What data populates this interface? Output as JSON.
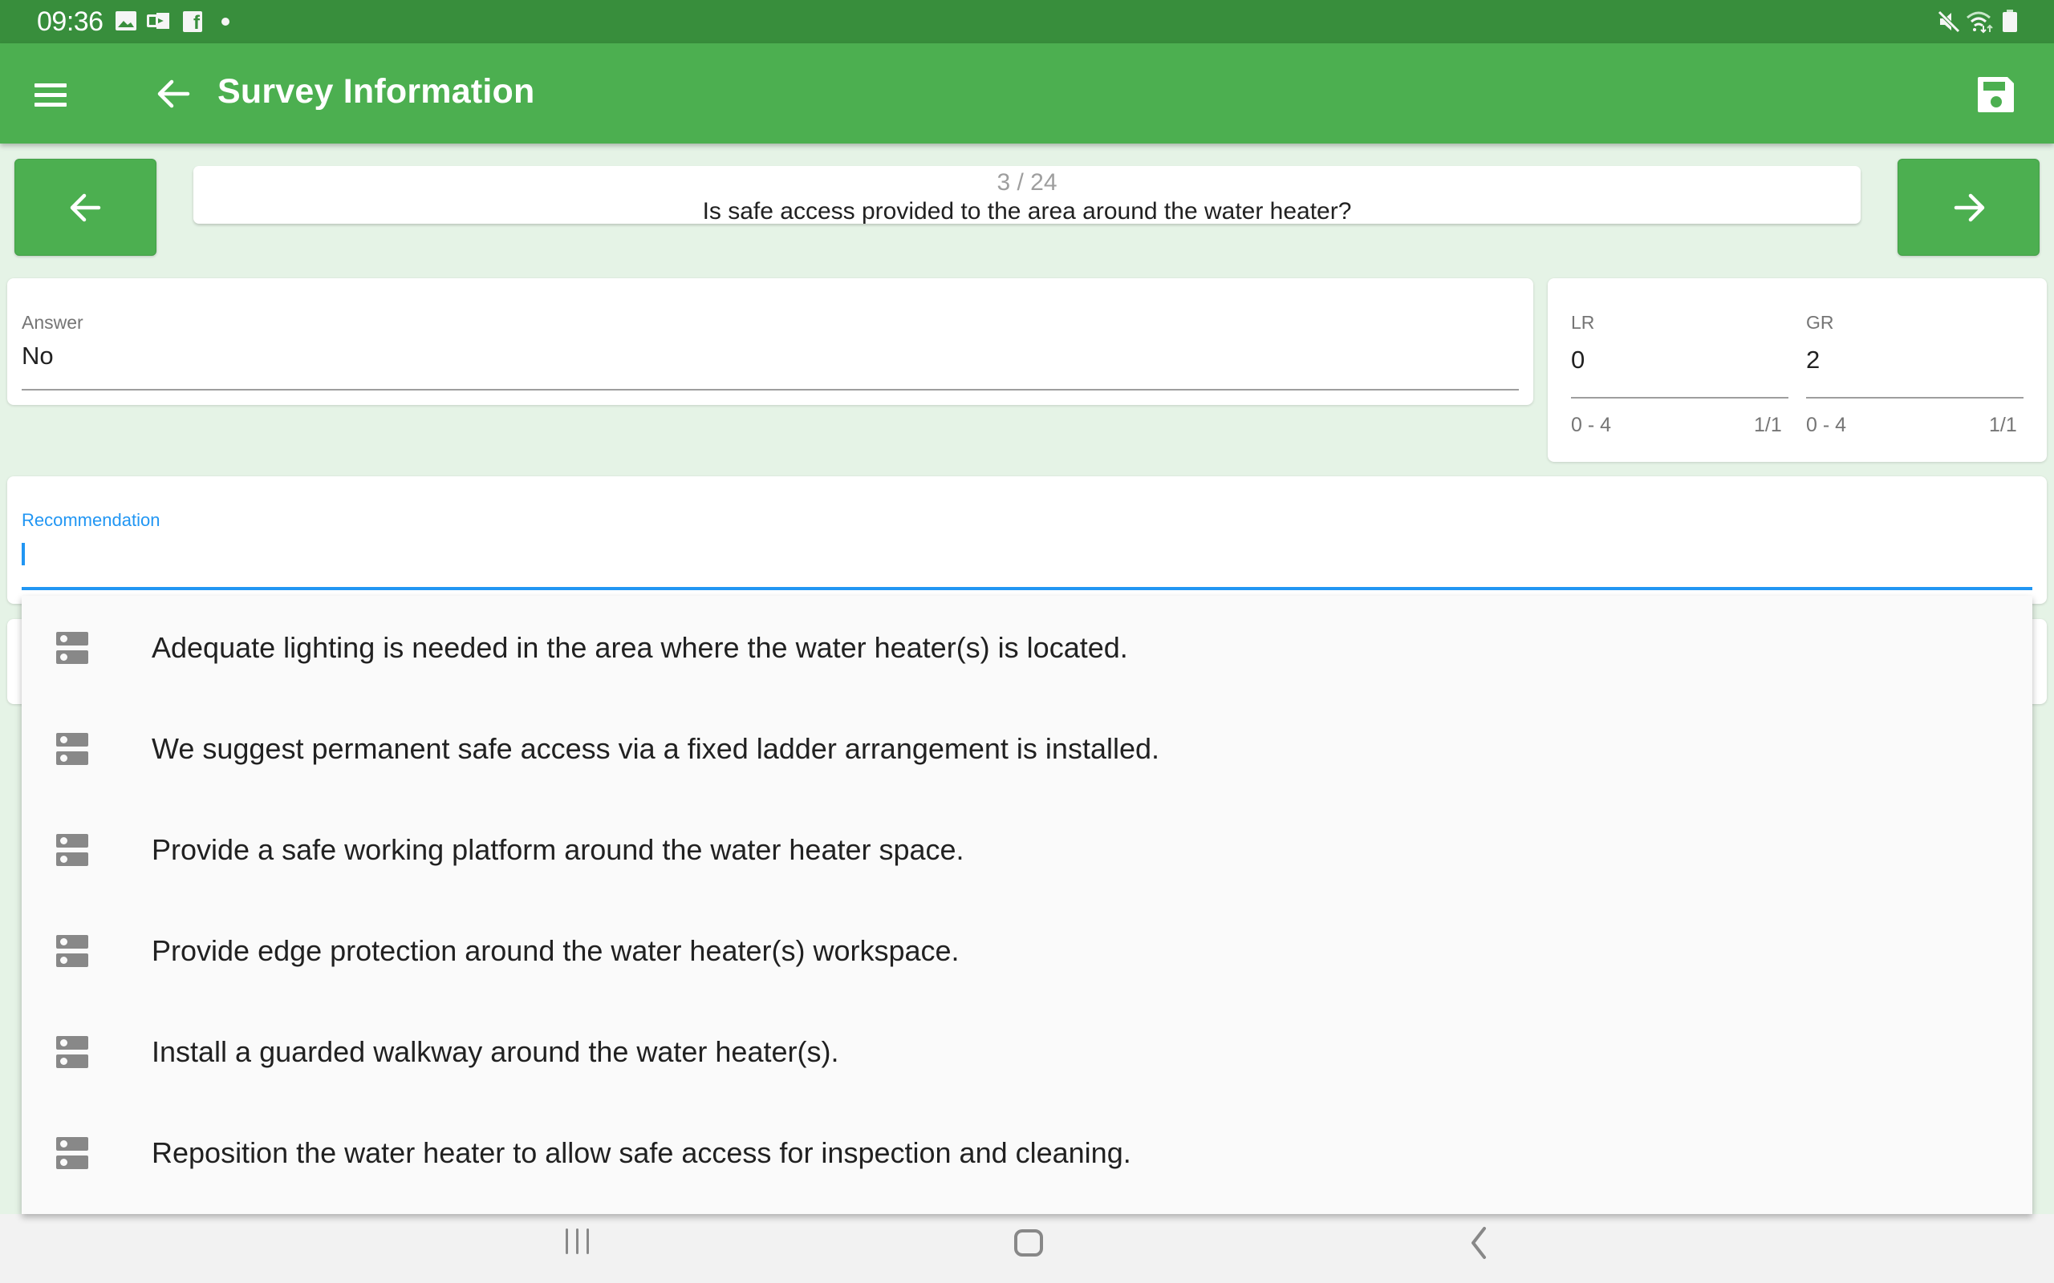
{
  "status_bar": {
    "time": "09:36",
    "left_icons": [
      "gallery-icon",
      "outlook-icon",
      "facebook-icon",
      "notification-dot"
    ],
    "right_icons": [
      "mute-icon",
      "wifi-icon",
      "battery-icon"
    ],
    "facebook_glyph": "f"
  },
  "toolbar": {
    "title": "Survey Information",
    "menu_icon": "hamburger-menu-icon",
    "back_icon": "arrow-left-icon",
    "save_icon": "floppy-disk-save-icon"
  },
  "question_nav": {
    "prev_icon": "arrow-left-icon",
    "next_icon": "arrow-right-icon",
    "counter": "3 / 24",
    "question": "Is safe access provided to the area around the water heater?"
  },
  "answer": {
    "label": "Answer",
    "value": "No"
  },
  "scores": [
    {
      "label": "LR",
      "value": "0",
      "range": "0 - 4",
      "count": "1/1"
    },
    {
      "label": "GR",
      "value": "2",
      "range": "0 - 4",
      "count": "1/1"
    }
  ],
  "recommendation": {
    "label": "Recommendation",
    "value": "",
    "focused": true,
    "suggestions": [
      "Adequate lighting is needed in the area where the water heater(s) is located.",
      "We suggest permanent safe access via a fixed ladder arrangement is installed.",
      "Provide a safe working platform around the water heater space.",
      "Provide edge protection around the water heater(s) workspace.",
      "Install a guarded walkway around the water heater(s).",
      "Reposition the water heater to allow safe access for inspection and cleaning."
    ],
    "suggestion_icon": "storage-list-icon"
  },
  "android_nav": {
    "recents_icon": "recents-icon",
    "home_icon": "home-icon",
    "back_icon": "back-chevron-icon"
  },
  "colors": {
    "status_bar": "#388e3c",
    "primary": "#4caf50",
    "background": "#e5f3e6",
    "accent": "#2196f3",
    "nav_bar": "#f2f2f2"
  }
}
